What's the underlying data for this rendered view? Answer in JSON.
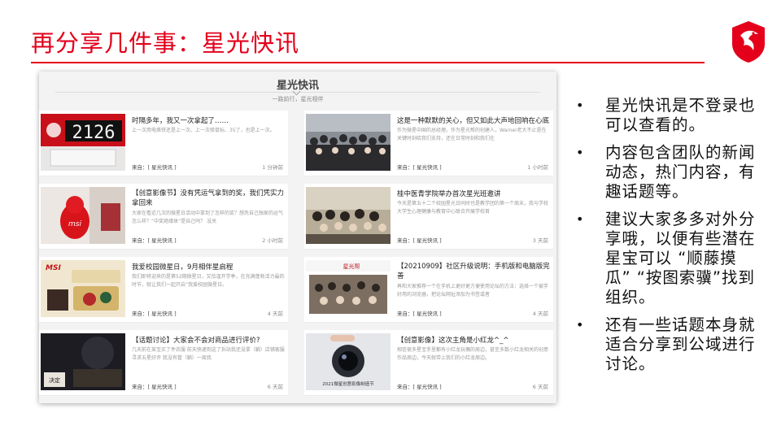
{
  "slide": {
    "title": "再分享几件事：星光快讯",
    "accent": "#e4001b"
  },
  "screenshot": {
    "name": "星光快讯",
    "subtitle": "一路前行，星光相伴",
    "cards": [
      {
        "title": "时隔多年，我又一次拿起了……",
        "desc": "上一次用电烙铁还是上一次、上一次修鼠标、35了，也是上一次。",
        "source": "来自：[ 星光快讯 ]",
        "time": "1 分钟前",
        "thumb": "clock",
        "clock_text": "2126"
      },
      {
        "title": "这是一种默默的关心，但又如此大声地回响在心底",
        "desc": "作为微星中国的总经理，作为星光帮的创建人，Warner老大不止是在关键时刻给我们支持，还在日常时刻和我们在",
        "source": "来自：[ 星光快讯 ]",
        "time": "1 小时前",
        "thumb": "crowd"
      },
      {
        "title": "【创意影像节】没有凭运气拿到的奖，我们凭实力拿回来",
        "desc": "大家在看近几次的微星日活动中拿到了怎样的奖？想凭自己独家的运气怎么样？“中奖绝缘体”是自己吗？ 没关",
        "source": "来自：[ 星光快讯 ]",
        "time": "2 小时前",
        "thumb": "dragon",
        "thumb_text": "msi"
      },
      {
        "title": "桂中医青学院举办首次星光班邀讲",
        "desc": "今天是第五十二个校园星光日同时也是教学团的第一个周末，我与学校大学生心理健康与教育中心联合开展学校首",
        "source": "来自：[ 星光快讯 ]",
        "time": "3 天前",
        "thumb": "group"
      },
      {
        "title": "我爱校园微星日，9月相伴星启程",
        "desc": "我们即将迎来的是第52期微星日，又恰逢开学季，在充满蓬勃活力最的时节，就让我们一起开启“我爱校园微星日。",
        "source": "来自：[ 星光快讯 ]",
        "time": "4 天前",
        "thumb": "poster",
        "thumb_text": "MSI"
      },
      {
        "title": "【20210909】社区升级说明：手机版和电脑版完善",
        "desc": "再和大家推荐一个在手机上更好更方便使用论坛的方法：选择一个被手好用的浏览器，把论坛网址添加为书签或者",
        "source": "来自：[ 星光快讯 ]",
        "time": "4 天前",
        "thumb": "community",
        "thumb_text": "星光帮"
      },
      {
        "title": "【话题讨论】大家会不会对商品进行评价?",
        "desc": "几天前在某宝买了件衣服 前天快递到这了拆站我还没拿（躺）店铺客服寻求五星好评 我没有管（躺）一周我",
        "source": "来自：[ 星光快讯 ]",
        "time": "6 天前",
        "thumb": "dark",
        "thumb_text": "决定"
      },
      {
        "title": "【创意影像】这次主角是小红龙^_^",
        "desc": "相信很多星宝手里都有小红龙玩偶的周边，甚至多数小红龙相关的创意作品周边，今天就带上我们的小红龙周边。",
        "source": "来自：[ 星光快讯 ]",
        "time": "6 天前",
        "thumb": "lens",
        "thumb_text": "2021微星创意影像制造节"
      }
    ]
  },
  "bullets": [
    "星光快讯是不登录也可以查看的。",
    "内容包含团队的新闻动态，热门内容，有趣话题等。",
    "建议大家多多对外分享哦，以便有些潜在星宝可以 “顺藤摸瓜” “按图索骥”找到组织。",
    "还有一些话题本身就适合分享到公域进行讨论。"
  ],
  "icons": {
    "logo": "msi-dragon-shield-icon",
    "bullet": "•"
  }
}
